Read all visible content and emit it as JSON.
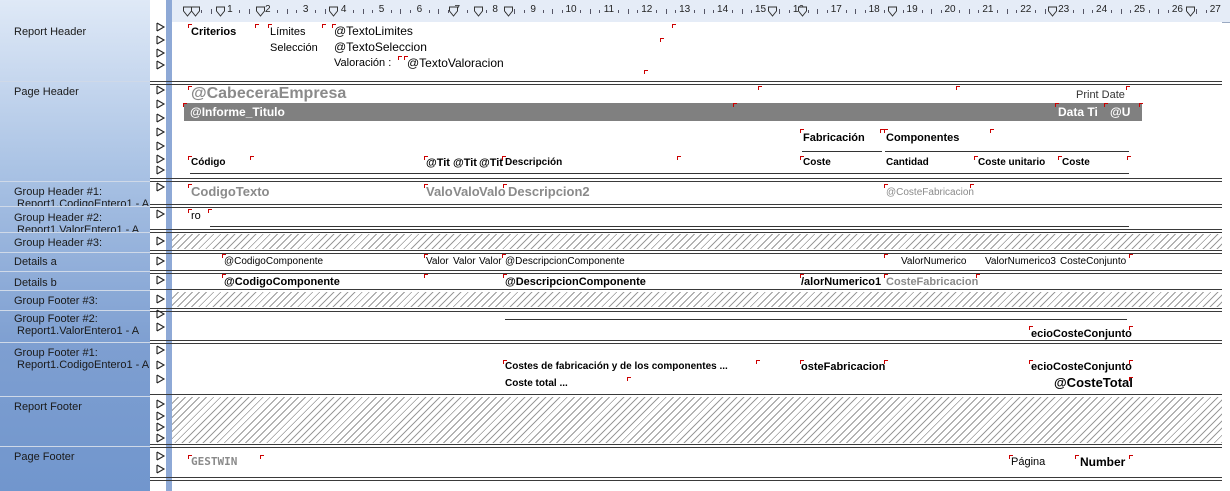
{
  "ruler": {
    "numbers": [
      "1",
      "2",
      "3",
      "4",
      "5",
      "6",
      "7",
      "8",
      "9",
      "10",
      "11",
      "12",
      "13",
      "14",
      "15",
      "16",
      "17",
      "18",
      "19",
      "20",
      "21",
      "22",
      "23",
      "24",
      "25",
      "26",
      "27"
    ]
  },
  "sections": {
    "report_header": {
      "label": "Report Header"
    },
    "page_header": {
      "label": "Page Header"
    },
    "group_header_1": {
      "label": "Group Header #1:",
      "sub": "Report1.CodigoEntero1 - A"
    },
    "group_header_2": {
      "label": "Group Header #2:",
      "sub": "Report1.ValorEntero1 - A"
    },
    "group_header_3": {
      "label": "Group Header #3:"
    },
    "details_a": {
      "label": "Details a"
    },
    "details_b": {
      "label": "Details b"
    },
    "group_footer_3": {
      "label": "Group Footer #3:"
    },
    "group_footer_2": {
      "label": "Group Footer #2:",
      "sub": "Report1.ValorEntero1 - A"
    },
    "group_footer_1": {
      "label": "Group Footer #1:",
      "sub": "Report1.CodigoEntero1 - A"
    },
    "report_footer": {
      "label": "Report Footer"
    },
    "page_footer": {
      "label": "Page Footer"
    }
  },
  "report_header": {
    "criterios": "Criterios",
    "limites": "Límites",
    "seleccion": "Selección",
    "valoracion": "Valoración :",
    "texto_limites": "@TextoLimites",
    "texto_seleccion": "@TextoSeleccion",
    "texto_valoracion": "@TextoValoracion"
  },
  "page_header": {
    "cabecera_empresa": "@CabeceraEmpresa",
    "print_date": "Print Date",
    "informe_titulo": "@Informe_Titulo",
    "data_ti": "Data Ti",
    "at_u": "@U",
    "fabricacion": "Fabricación",
    "componentes": "Componentes",
    "codigo": "Código",
    "tit1": "@Tit",
    "tit2": "@Tit",
    "tit3": "@Tit",
    "descripcion": "Descripción",
    "coste1": "Coste",
    "cantidad": "Cantidad",
    "coste_unitario": "Coste unitario",
    "coste2": "Coste"
  },
  "group_header_1": {
    "codigo_texto": "CodigoTexto",
    "valor1": "Valo",
    "valor2": "Valo",
    "valor3": "Valo",
    "descripcion2": "Descripcion2",
    "coste_fabricacion": "@CosteFabricacion"
  },
  "group_header_2": {
    "ro": "ro"
  },
  "details_a": {
    "codigo_componente": "@CodigoComponente",
    "valor1": "Valor",
    "valor2": "Valor",
    "valor3": "Valor",
    "descripcion_componente": "@DescripcionComponente",
    "valor_numerico1": "ValorNumerico",
    "valor_numerico2": "ValorNumerico3",
    "coste_conjunto": "CosteConjunto"
  },
  "details_b": {
    "codigo_componente": "@CodigoComponente",
    "descripcion_componente": "@DescripcionComponente",
    "valor_numerico": "/alorNumerico1",
    "coste_fabricacion": "CosteFabricacion"
  },
  "group_footer_2": {
    "precio_coste_conjunto": "ecioCosteConjunto"
  },
  "group_footer_1": {
    "costes_label": "Costes de fabricación y de los componentes ...",
    "coste_total_label": "Coste total ...",
    "coste_fabricacion": "osteFabricacion",
    "precio_coste_conjunto": "ecioCosteConjunto",
    "coste_total": "@CosteTotal"
  },
  "page_footer": {
    "gestwin": "GESTWIN",
    "pagina": "Página",
    "number": "Number"
  }
}
